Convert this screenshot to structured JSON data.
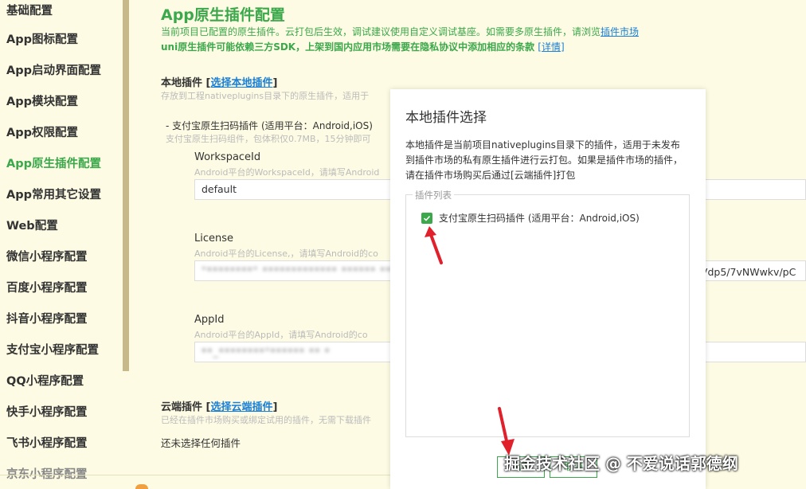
{
  "sidebar": {
    "items": [
      {
        "label": "基础配置"
      },
      {
        "label": "App图标配置"
      },
      {
        "label": "App启动界面配置"
      },
      {
        "label": "App模块配置"
      },
      {
        "label": "App权限配置"
      },
      {
        "label": "App原生插件配置"
      },
      {
        "label": "App常用其它设置"
      },
      {
        "label": "Web配置"
      },
      {
        "label": "微信小程序配置"
      },
      {
        "label": "百度小程序配置"
      },
      {
        "label": "抖音小程序配置"
      },
      {
        "label": "支付宝小程序配置"
      },
      {
        "label": "QQ小程序配置"
      },
      {
        "label": "快手小程序配置"
      },
      {
        "label": "飞书小程序配置"
      },
      {
        "label": "京东小程序配置"
      }
    ]
  },
  "page": {
    "title": "App原生插件配置",
    "desc_text": "当前项目已配置的原生插件。云打包后生效，调试建议使用自定义调试基座。如需要多原生插件，请浏览",
    "desc_link": "插件市场",
    "warn_text": "uni原生插件可能依赖三方SDK，上架到国内应用市场需要在隐私协议中添加相应的条款",
    "warn_link": "[详情]"
  },
  "local_plugins": {
    "title_prefix": "本地插件 [",
    "title_link": "选择本地插件",
    "title_suffix": "]",
    "sub": "存放到工程nativeplugins目录下的原生插件，适用于",
    "plugin_name": "- 支付宝原生扫码插件 (适用平台：Android,iOS)",
    "plugin_sub": "支付宝原生扫码组件，包体积仅0.7MB，15分钟即可",
    "fields": [
      {
        "label": "WorkspaceId",
        "hint": "Android平台的WorkspaceId，请填写Android",
        "value": "default"
      },
      {
        "label": "License",
        "hint": "Android平台的License,，请填写Android的co",
        "value": "\"********\" ************* ****** *****"
      },
      {
        "label": "AppId",
        "hint": "Android平台的AppId，请填写Android的co",
        "value": "**_********\"****** ** *"
      }
    ],
    "license_tail": "gVdp5/7vNWwkv/pC"
  },
  "cloud_plugins": {
    "title_prefix": "云端插件 [",
    "title_link": "选择云端插件",
    "title_suffix": "]",
    "sub": "已经在插件市场购买或绑定试用的插件，无需下载插件",
    "none_text": "还未选择任何插件"
  },
  "dialog": {
    "title": "本地插件选择",
    "desc": "本地插件是当前项目nativeplugins目录下的插件，适用于未发布到插件市场的私有原生插件进行云打包。如果是插件市场的插件，请在插件市场购买后通过[云端插件]打包",
    "legend": "插件列表",
    "plugins": [
      {
        "label": "支付宝原生扫码插件 (适用平台：Android,iOS)",
        "checked": true
      }
    ],
    "ok_label": "确定",
    "cancel_label": "取消"
  },
  "watermark": "掘金技术社区 @ 不爱说话郭德纲",
  "colors": {
    "accent": "#3ba84b",
    "link": "#1a7fd6",
    "background": "#fdfbe3",
    "arrow": "#e0202a"
  }
}
